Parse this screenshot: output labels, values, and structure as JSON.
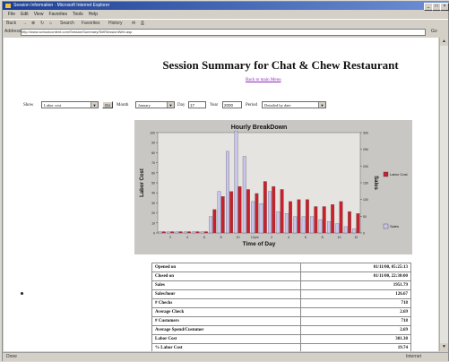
{
  "window": {
    "title": "Session Information - Microsoft Internet Explorer"
  },
  "menu": [
    "File",
    "Edit",
    "View",
    "Favorites",
    "Tools",
    "Help"
  ],
  "toolbar": {
    "back": "Back",
    "search": "Search",
    "favorites": "Favorites",
    "history": "History"
  },
  "address": {
    "label": "Address",
    "url": "http://www.schoolcontent.com/SessionSummary/SelfSessionWeb.asp",
    "go": "Go"
  },
  "status": {
    "text": "Done",
    "zone": "Internet"
  },
  "page": {
    "title": "Session Summary for Chat & Chew Restaurant",
    "back_link": "Back to main Menu"
  },
  "filters": {
    "show_label": "Show",
    "show_value": "Labor cost",
    "go_button": "Go",
    "month_label": "Month",
    "month_value": "January",
    "day_label": "Day",
    "day_value": "17",
    "year_label": "Year",
    "year_value": "2000",
    "period_label": "Period",
    "period_value": "Detailed by date"
  },
  "chart_data": {
    "type": "bar",
    "title": "Hourly BreakDown",
    "xlabel": "Time of Day",
    "ylabel": "Labor Cost",
    "y2label": "Sales",
    "ylim": [
      0,
      100
    ],
    "y2lim": [
      0,
      300
    ],
    "yticks": [
      "0",
      "10",
      "20",
      "30",
      "40",
      "50",
      "60",
      "70",
      "80",
      "90",
      "100"
    ],
    "y2ticks": [
      "0",
      "50",
      "100",
      "150",
      "200",
      "250",
      "300"
    ],
    "x_tick_labels": [
      "2",
      "4",
      "6",
      "8",
      "10",
      "12pm",
      "2",
      "4",
      "6",
      "8",
      "10",
      "12"
    ],
    "legend": [
      "Labor Cost",
      "Sales"
    ],
    "colors": {
      "labor": "#c8202c",
      "sales": "#c8c4ec",
      "panel": "#c9c7c4",
      "plot": "#e6e4e0"
    },
    "labor": [
      0,
      0,
      0,
      0,
      0,
      0,
      22,
      35,
      40,
      45,
      42,
      38,
      50,
      45,
      42,
      30,
      32,
      32,
      25,
      25,
      27,
      30,
      20,
      18
    ],
    "sales": [
      0,
      0,
      0,
      0,
      0,
      0,
      15,
      40,
      80,
      100,
      75,
      30,
      28,
      40,
      20,
      18,
      15,
      15,
      15,
      12,
      10,
      8,
      5,
      3
    ]
  },
  "summary": [
    {
      "label": "Opened on",
      "value": "01/11/00, 05:25:13"
    },
    {
      "label": "Closed on",
      "value": "01/11/00, 22:30:00"
    },
    {
      "label": "Sales",
      "value": "1951.79"
    },
    {
      "label": "Sales/hour",
      "value": "126.67"
    },
    {
      "label": "# Checks",
      "value": "718"
    },
    {
      "label": "Average Check",
      "value": "2.69"
    },
    {
      "label": "# Customers",
      "value": "718"
    },
    {
      "label": "Average Spend/Customer",
      "value": "2.69"
    },
    {
      "label": "Labor Cost",
      "value": "381.38"
    },
    {
      "label": "% Labor Cost",
      "value": "19.74"
    }
  ]
}
